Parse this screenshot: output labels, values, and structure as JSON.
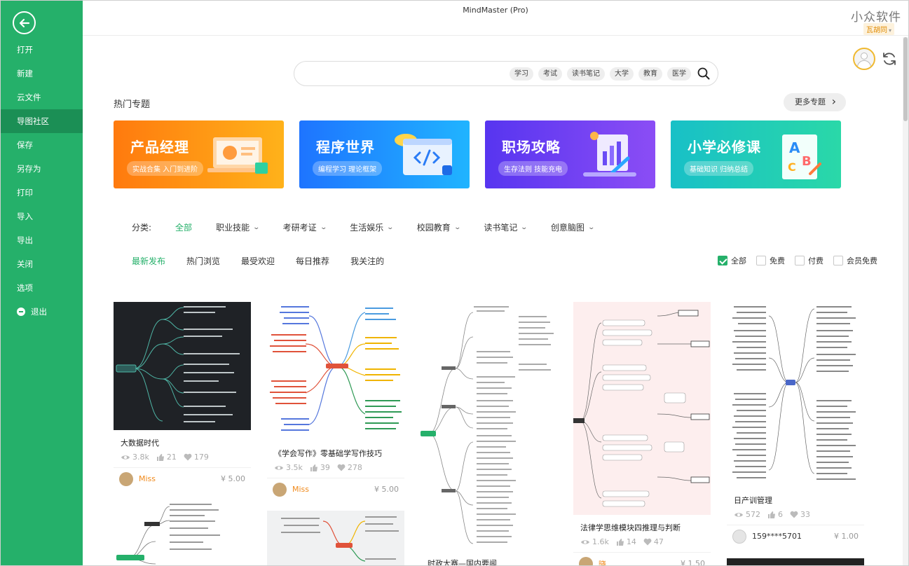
{
  "sidebar": {
    "items": [
      {
        "label": "打开"
      },
      {
        "label": "新建"
      },
      {
        "label": "云文件"
      },
      {
        "label": "导图社区"
      },
      {
        "label": "保存"
      },
      {
        "label": "另存为"
      },
      {
        "label": "打印"
      },
      {
        "label": "导入"
      },
      {
        "label": "导出"
      },
      {
        "label": "关闭"
      },
      {
        "label": "选项"
      },
      {
        "label": "退出"
      }
    ],
    "active": "导图社区"
  },
  "titlebar": {
    "title": "MindMaster (Pro)",
    "watermark": "小众软件",
    "username": "瓦胡同"
  },
  "search": {
    "tags": [
      "学习",
      "考试",
      "读书笔记",
      "大学",
      "教育",
      "医学"
    ]
  },
  "hot": {
    "title": "热门专题",
    "more": "更多专题",
    "banners": [
      {
        "title": "产品经理",
        "subtitle": "实战合集 入门到进阶"
      },
      {
        "title": "程序世界",
        "subtitle": "编程学习 理论框架"
      },
      {
        "title": "职场攻略",
        "subtitle": "生存法则 技能充电"
      },
      {
        "title": "小学必修课",
        "subtitle": "基础知识 归纳总结"
      }
    ]
  },
  "categories": {
    "label": "分类:",
    "items": [
      "全部",
      "职业技能",
      "考研考证",
      "生活娱乐",
      "校园教育",
      "读书笔记",
      "创意脑图"
    ]
  },
  "tabs": [
    "最新发布",
    "热门浏览",
    "最受欢迎",
    "每日推荐",
    "我关注的"
  ],
  "filters": [
    "全部",
    "免费",
    "付费",
    "会员免费"
  ],
  "cards": [
    {
      "title": "大数据时代",
      "views": "3.8k",
      "likes": "21",
      "hearts": "179",
      "author": "Miss",
      "price": "¥ 5.00"
    },
    {
      "title": "《学会写作》零基础学写作技巧",
      "views": "3.5k",
      "likes": "39",
      "hearts": "278",
      "author": "Miss",
      "price": "¥ 5.00"
    },
    {
      "title": "时政大赛—国内要闻"
    },
    {
      "title": "法律学思维模块四推理与判断",
      "views": "1.6k",
      "likes": "14",
      "hearts": "47",
      "author": "晓",
      "price": "¥ 1.50"
    },
    {
      "title": "日产训管理",
      "views": "572",
      "likes": "6",
      "hearts": "33",
      "author": "159****5701",
      "price": "¥ 1.00"
    }
  ],
  "colors": {
    "accent": "#25b06a",
    "price_user": "#f08a1c"
  }
}
